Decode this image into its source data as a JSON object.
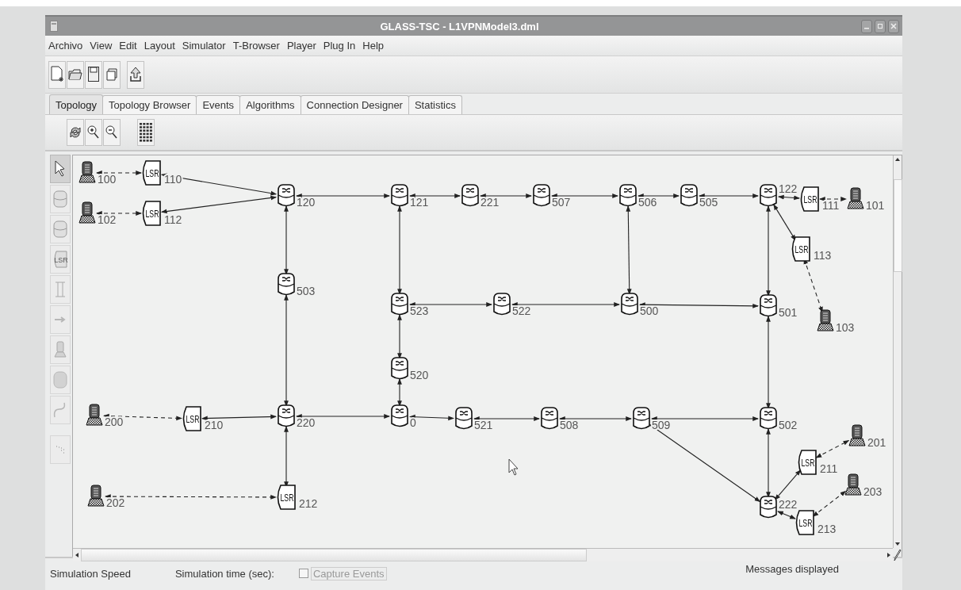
{
  "window": {
    "title": "GLASS-TSC - L1VPNModel3.dml"
  },
  "menu": [
    "Archivo",
    "View",
    "Edit",
    "Layout",
    "Simulator",
    "T-Browser",
    "Player",
    "Plug In",
    "Help"
  ],
  "tabs": [
    {
      "label": "Topology",
      "selected": true
    },
    {
      "label": "Topology Browser",
      "selected": false
    },
    {
      "label": "Events",
      "selected": false
    },
    {
      "label": "Algorithms",
      "selected": false
    },
    {
      "label": "Connection Designer",
      "selected": false
    },
    {
      "label": "Statistics",
      "selected": false
    }
  ],
  "palette": [
    {
      "kind": "select",
      "selected": true,
      "disabled": false
    },
    {
      "kind": "router",
      "selected": false,
      "disabled": true
    },
    {
      "kind": "router",
      "selected": false,
      "disabled": true
    },
    {
      "kind": "lsr",
      "text": "LSR",
      "selected": false,
      "disabled": true
    },
    {
      "kind": "link",
      "selected": false,
      "disabled": true
    },
    {
      "kind": "arrow",
      "selected": false,
      "disabled": true
    },
    {
      "kind": "host",
      "selected": false,
      "disabled": true
    },
    {
      "kind": "cylinder",
      "selected": false,
      "disabled": true
    },
    {
      "kind": "curve",
      "selected": false,
      "disabled": true
    },
    {
      "kind": "dots",
      "selected": false,
      "disabled": true
    }
  ],
  "topology": {
    "nodes": [
      {
        "kind": "host",
        "label": "100"
      },
      {
        "kind": "lsr",
        "label": "110",
        "icon_text": "LSR"
      },
      {
        "kind": "host",
        "label": "102"
      },
      {
        "kind": "lsr",
        "label": "112",
        "icon_text": "LSR"
      },
      {
        "kind": "router",
        "label": "120"
      },
      {
        "kind": "router",
        "label": "121"
      },
      {
        "kind": "router",
        "label": "221"
      },
      {
        "kind": "router",
        "label": "507"
      },
      {
        "kind": "router",
        "label": "506"
      },
      {
        "kind": "router",
        "label": "505"
      },
      {
        "kind": "router",
        "label": "122"
      },
      {
        "kind": "lsr",
        "label": "111",
        "icon_text": "LSR"
      },
      {
        "kind": "host",
        "label": "101"
      },
      {
        "kind": "lsr",
        "label": "113",
        "icon_text": "LSR"
      },
      {
        "kind": "host",
        "label": "103"
      },
      {
        "kind": "router",
        "label": "503"
      },
      {
        "kind": "router",
        "label": "523"
      },
      {
        "kind": "router",
        "label": "522"
      },
      {
        "kind": "router",
        "label": "500"
      },
      {
        "kind": "router",
        "label": "501"
      },
      {
        "kind": "router",
        "label": "520"
      },
      {
        "kind": "host",
        "label": "200"
      },
      {
        "kind": "lsr",
        "label": "210",
        "icon_text": "LSR"
      },
      {
        "kind": "router",
        "label": "220"
      },
      {
        "kind": "router",
        "label": "0"
      },
      {
        "kind": "router",
        "label": "521"
      },
      {
        "kind": "router",
        "label": "508"
      },
      {
        "kind": "router",
        "label": "509"
      },
      {
        "kind": "router",
        "label": "502"
      },
      {
        "kind": "host",
        "label": "201"
      },
      {
        "kind": "lsr",
        "label": "211",
        "icon_text": "LSR"
      },
      {
        "kind": "host",
        "label": "203"
      },
      {
        "kind": "host",
        "label": "202"
      },
      {
        "kind": "lsr",
        "label": "212",
        "icon_text": "LSR"
      },
      {
        "kind": "router",
        "label": "222"
      },
      {
        "kind": "lsr",
        "label": "213",
        "icon_text": "LSR"
      }
    ]
  },
  "status_bar": {
    "speed_label": "Simulation Speed",
    "time_label": "Simulation time (sec):",
    "capture": {
      "label": "Capture Events",
      "checked": false,
      "disabled": true
    },
    "messages_label": "Messages displayed"
  }
}
